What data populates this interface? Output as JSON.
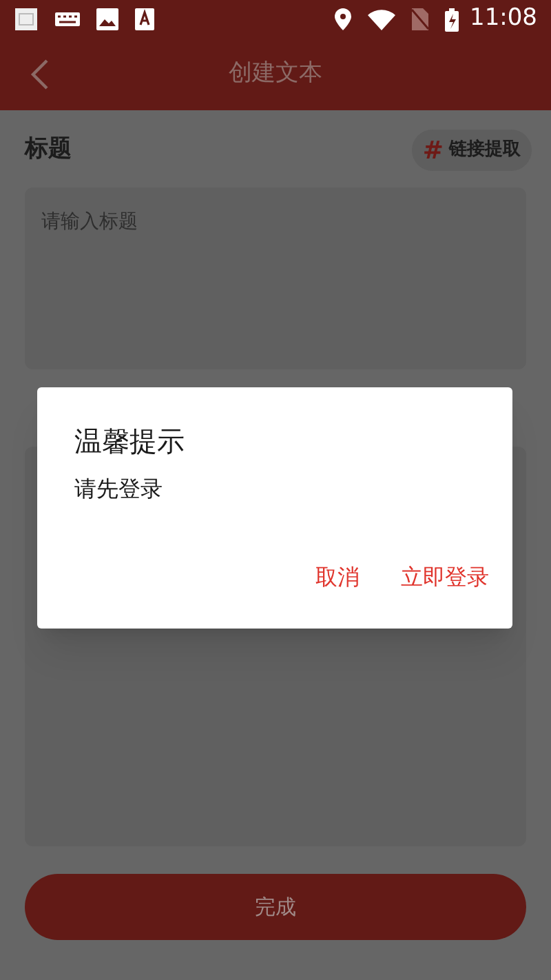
{
  "status_bar": {
    "time": "11:08"
  },
  "header": {
    "title": "创建文本"
  },
  "title_section": {
    "label": "标题",
    "link_extract": {
      "icon": "#",
      "label": "链接提取"
    },
    "placeholder": "请输入标题"
  },
  "dialog": {
    "title": "温馨提示",
    "message": "请先登录",
    "buttons": [
      {
        "label": "取消"
      },
      {
        "label": "立即登录"
      }
    ]
  },
  "submit_button": {
    "label": "完成"
  }
}
